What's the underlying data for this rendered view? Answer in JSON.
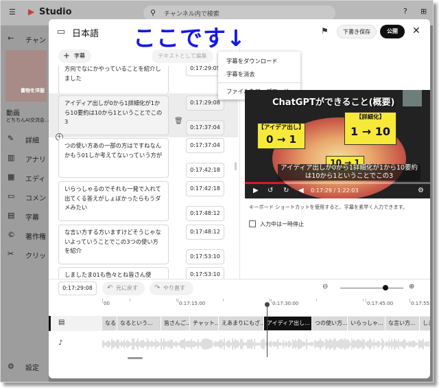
{
  "bg": {
    "logo": "Studio",
    "search_placeholder": "チャンネル内で検索",
    "channel_label": "チャン",
    "thumb_caption": "書物を洋服",
    "video_label": "動画",
    "video_sub": "どちちんAI交流会...",
    "nav": [
      {
        "icon": "pencil-icon",
        "label": "詳細"
      },
      {
        "icon": "analytics-icon",
        "label": "アナリ"
      },
      {
        "icon": "editor-icon",
        "label": "エディ"
      },
      {
        "icon": "comment-icon",
        "label": "コメン"
      },
      {
        "icon": "subtitles-icon",
        "label": "字幕"
      },
      {
        "icon": "copyright-icon",
        "label": "著作権"
      },
      {
        "icon": "clip-icon",
        "label": "クリッ"
      }
    ],
    "settings": "設定"
  },
  "dialog": {
    "title": "日本語",
    "annotation": "ここです↓",
    "draft_label": "下書き保存",
    "publish_label": "公開",
    "add_subtitle_label": "字幕",
    "edit_as_text_label": "テキストとして編集"
  },
  "menu": {
    "items": [
      "字幕をダウンロード",
      "字幕を消去",
      "ファイルをアップロード"
    ]
  },
  "cues": [
    {
      "text": "方向でなにかやっていることを紹介しました",
      "start": "0:17:29:05",
      "end": ""
    },
    {
      "text": "アイディア出しが0から1詳細化が1から10要約は10から1ということでこの3",
      "start": "0:17:29:08",
      "end": "0:17:37:04"
    },
    {
      "text": "つの使い方あの一部の方はですねなんかもう01しか考えてないっていう方が",
      "start": "0:17:37:04",
      "end": "0:17:42:18"
    },
    {
      "text": "いらっしゃるのでそれも一発で入れて出てくる答えがしょぼかったらもうダメみたい",
      "start": "0:17:42:18",
      "end": "0:17:48:12"
    },
    {
      "text": "な言い方する方いますけどそうじゃないよっていうことでこの3つの使い方を紹介",
      "start": "0:17:48:12",
      "end": "0:17:53:10"
    },
    {
      "text": "しましたま01も色々とね皆さん使",
      "start": "0:17:53:10",
      "end": ""
    }
  ],
  "video": {
    "title": "ChatGPTができること(概要)",
    "box1": "【アイデア出し】",
    "box1_val": "0 → 1",
    "box2": "【詳細化】",
    "box2_val": "1 → 10",
    "box3_val": "10 → 1",
    "caption": "アイディア出しが0から1詳細化が1から10要約は10から1ということでこの3",
    "time": "0:17:29 / 1:22:03",
    "progress": 0.213
  },
  "keyboard_hint": "キーボード ショートカットを使用すると、字幕を素早く入力できます。",
  "pause_label": "入力中は一時停止",
  "timeline": {
    "current": "0:17:29:08",
    "undo_label": "元に戻す",
    "redo_label": "やり直す",
    "zoom_level": 0.72,
    "ruler": [
      "00",
      "0:17:15:00",
      "0:17:30:00",
      "0:17:45:00",
      "0:17:55:14"
    ],
    "segments": [
      {
        "text": "なる...",
        "active": false
      },
      {
        "text": "なるという...",
        "active": false
      },
      {
        "text": "皆さんご...",
        "active": false
      },
      {
        "text": "チャット...",
        "active": false
      },
      {
        "text": "えあまりにもざ...",
        "active": false
      },
      {
        "text": "アイディア出し...",
        "active": true
      },
      {
        "text": "つの使い方...",
        "active": false
      },
      {
        "text": "いらっしゃ...",
        "active": false
      },
      {
        "text": "な言い方...",
        "active": false
      },
      {
        "text": "しま",
        "active": false
      }
    ]
  }
}
